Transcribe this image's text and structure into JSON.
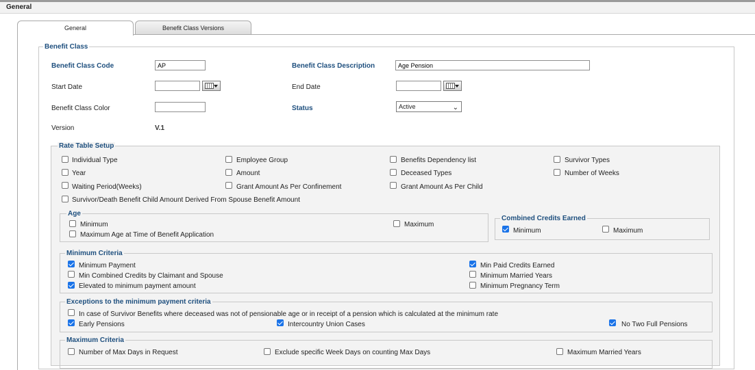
{
  "header": {
    "title": "General"
  },
  "tabs": [
    {
      "label": "General",
      "active": true
    },
    {
      "label": "Benefit Class Versions",
      "active": false
    }
  ],
  "benefit_class": {
    "legend": "Benefit Class",
    "code_label": "Benefit Class Code",
    "code_value": "AP",
    "description_label": "Benefit Class Description",
    "description_value": "Age Pension",
    "start_date_label": "Start Date",
    "start_date_value": "",
    "end_date_label": "End Date",
    "end_date_value": "",
    "color_label": "Benefit Class Color",
    "color_value": "",
    "status_label": "Status",
    "status_value": "Active",
    "version_label": "Version",
    "version_value": "V.1"
  },
  "rate_table": {
    "legend": "Rate Table Setup",
    "items": [
      {
        "label": "Individual Type",
        "checked": false
      },
      {
        "label": "Employee Group",
        "checked": false
      },
      {
        "label": "Benefits Dependency list",
        "checked": false
      },
      {
        "label": "Survivor Types",
        "checked": false
      },
      {
        "label": "Year",
        "checked": false
      },
      {
        "label": "Amount",
        "checked": false
      },
      {
        "label": "Deceased Types",
        "checked": false
      },
      {
        "label": "Number of Weeks",
        "checked": false
      },
      {
        "label": "Waiting Period(Weeks)",
        "checked": false
      },
      {
        "label": "Grant Amount As Per Confinement",
        "checked": false
      },
      {
        "label": "Grant Amount As Per Child",
        "checked": false
      },
      {
        "label": "Survivor/Death Benefit Child Amount Derived From Spouse Benefit Amount",
        "checked": false
      }
    ]
  },
  "age": {
    "legend": "Age",
    "items": [
      {
        "label": "Minimum",
        "checked": false
      },
      {
        "label": "Maximum",
        "checked": false
      },
      {
        "label": "Maximum Age at Time of Benefit Application",
        "checked": false
      }
    ]
  },
  "combined_credits": {
    "legend": "Combined Credits Earned",
    "items": [
      {
        "label": "Minimum",
        "checked": true
      },
      {
        "label": "Maximum",
        "checked": false
      }
    ]
  },
  "minimum_criteria": {
    "legend": "Minimum Criteria",
    "items": [
      {
        "label": "Minimum Payment",
        "checked": true
      },
      {
        "label": "Min Combined Credits by Claimant and Spouse",
        "checked": false
      },
      {
        "label": "Elevated to minimum payment amount",
        "checked": true
      },
      {
        "label": "Min Paid Credits Earned",
        "checked": true
      },
      {
        "label": "Minimum Married Years",
        "checked": false
      },
      {
        "label": "Minimum Pregnancy Term",
        "checked": false
      }
    ]
  },
  "exceptions": {
    "legend": "Exceptions to the minimum payment criteria",
    "items": [
      {
        "label": "In case of Survivor Benefits where deceased was not of pensionable age or in receipt of a pension which is calculated at the minimum rate",
        "checked": false
      },
      {
        "label": "Early Pensions",
        "checked": true
      },
      {
        "label": "Intercountry Union Cases",
        "checked": true
      },
      {
        "label": "No Two Full Pensions",
        "checked": true
      }
    ]
  },
  "maximum_criteria": {
    "legend": "Maximum Criteria",
    "items": [
      {
        "label": "Number of Max Days in Request",
        "checked": false
      },
      {
        "label": "Exclude specific Week Days on counting Max Days",
        "checked": false
      },
      {
        "label": "Maximum Married Years",
        "checked": false
      }
    ]
  },
  "icons": {
    "calendar": "calendar-icon",
    "dropdown": "chevron-down-icon"
  },
  "colors": {
    "accent": "#1e4f7e",
    "checkbox_checked": "#1a73e8"
  }
}
